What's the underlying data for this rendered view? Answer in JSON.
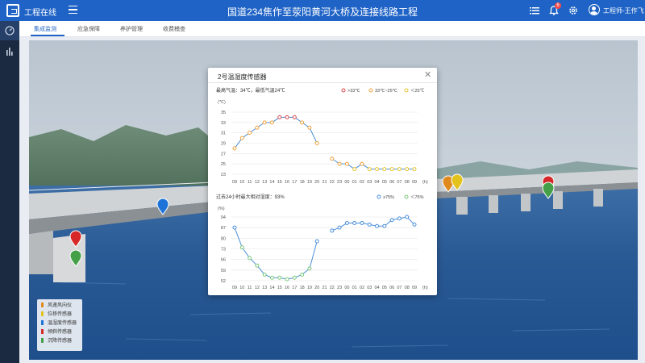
{
  "header": {
    "app_name": "工程在线",
    "page_title": "国道234焦作至荥阳黄河大桥及连接线路工程",
    "notification_count": "6",
    "user_name": "工程师-王作飞"
  },
  "subnav": {
    "tabs": [
      {
        "label": "集成监测",
        "active": true
      },
      {
        "label": "应急保障",
        "active": false
      },
      {
        "label": "养护管理",
        "active": false
      },
      {
        "label": "收费稽查",
        "active": false
      }
    ]
  },
  "legend": [
    {
      "label": "风速风向仪",
      "color": "#e08a1e"
    },
    {
      "label": "位移传感器",
      "color": "#e3c21b"
    },
    {
      "label": "温湿度传感器",
      "color": "#1e73d8"
    },
    {
      "label": "倾斜传感器",
      "color": "#d62828"
    },
    {
      "label": "沉降传感器",
      "color": "#43a047"
    }
  ],
  "modal": {
    "title": "2号温湿度传感器",
    "close_icon": "close-icon"
  },
  "chart_data": [
    {
      "type": "line",
      "subtitle": "最高气温：34℃，最低气温24℃",
      "ylabel": "(℃)",
      "xlabel": "(h)",
      "ylim": [
        23,
        35
      ],
      "yticks": [
        23,
        25,
        27,
        29,
        31,
        33,
        35
      ],
      "x": [
        "09",
        "10",
        "11",
        "12",
        "13",
        "14",
        "15",
        "16",
        "17",
        "18",
        "19",
        "20",
        "21",
        "22",
        "23",
        "00",
        "01",
        "02",
        "03",
        "04",
        "05",
        "06",
        "07",
        "08",
        "09"
      ],
      "values": [
        28,
        30,
        31,
        32,
        33,
        33,
        34,
        34,
        34,
        33,
        32,
        29,
        null,
        26,
        25,
        25,
        24,
        25,
        24,
        24,
        24,
        24,
        24,
        24,
        24
      ],
      "legend": [
        {
          "name": ">33℃",
          "color": "#e0494b"
        },
        {
          "name": "33℃~25℃",
          "color": "#f0a23b"
        },
        {
          "name": "＜25℃",
          "color": "#e8c430"
        }
      ],
      "line_color": "#4a8fd9",
      "legend_position": "top-right"
    },
    {
      "type": "line",
      "subtitle": "过去24小时最大相对湿度：93%",
      "ylabel": "(%)",
      "xlabel": "(h)",
      "ylim": [
        52,
        94
      ],
      "yticks": [
        52,
        59,
        66,
        73,
        80,
        87,
        94
      ],
      "x": [
        "09",
        "10",
        "11",
        "12",
        "13",
        "14",
        "15",
        "16",
        "17",
        "18",
        "19",
        "20",
        "21",
        "22",
        "23",
        "00",
        "01",
        "02",
        "03",
        "04",
        "05",
        "06",
        "07",
        "08",
        "09"
      ],
      "values": [
        87,
        74,
        67,
        62,
        56,
        54,
        54,
        53,
        54,
        56,
        60,
        78,
        null,
        85,
        87,
        90,
        90,
        90,
        89,
        88,
        88,
        92,
        93,
        94,
        89
      ],
      "legend": [
        {
          "name": "≥75%",
          "color": "#4a8fd9"
        },
        {
          "name": "＜75%",
          "color": "#7cc87a"
        }
      ],
      "line_color": "#4a8fd9",
      "legend_position": "top-right"
    }
  ]
}
